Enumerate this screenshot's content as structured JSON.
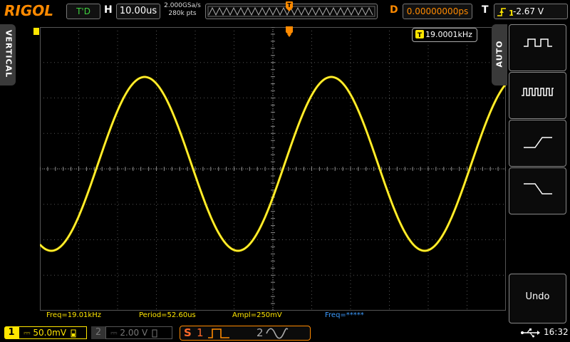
{
  "brand": "RIGOL",
  "top": {
    "run_state": "T'D",
    "h_label": "H",
    "timebase": "10.00us",
    "sample_rate": "2.000GSa/s",
    "memory_depth": "280k pts",
    "delay_label": "D",
    "delay": "0.00000000ps",
    "trigger_label": "T",
    "trigger_level": "-2.67 V"
  },
  "left_tab": "VERTICAL",
  "right_panel": {
    "tab": "AUTO",
    "buttons": [
      {
        "name": "period-waveform",
        "icon": "single-period-icon"
      },
      {
        "name": "multi-period-waveform",
        "icon": "multi-period-icon"
      },
      {
        "name": "rising-edge",
        "icon": "rising-edge-icon"
      },
      {
        "name": "falling-edge",
        "icon": "falling-edge-icon"
      }
    ],
    "undo": "Undo"
  },
  "screen": {
    "counter": "19.0001kHz",
    "trace_color": "#ffe600",
    "grid_color": "#555555"
  },
  "measurements": {
    "freq": "Freq=19.01kHz",
    "period": "Period=52.60us",
    "ampl": "Ampl=250mV",
    "freq2": "Freq=*****"
  },
  "bottom": {
    "ch1_num": "1",
    "ch1_scale": "50.0mV",
    "ch2_num": "2",
    "ch2_scale": "2.00 V",
    "source_s": "S",
    "source_1": "1",
    "source_2": "2",
    "clock": "16:32"
  }
}
